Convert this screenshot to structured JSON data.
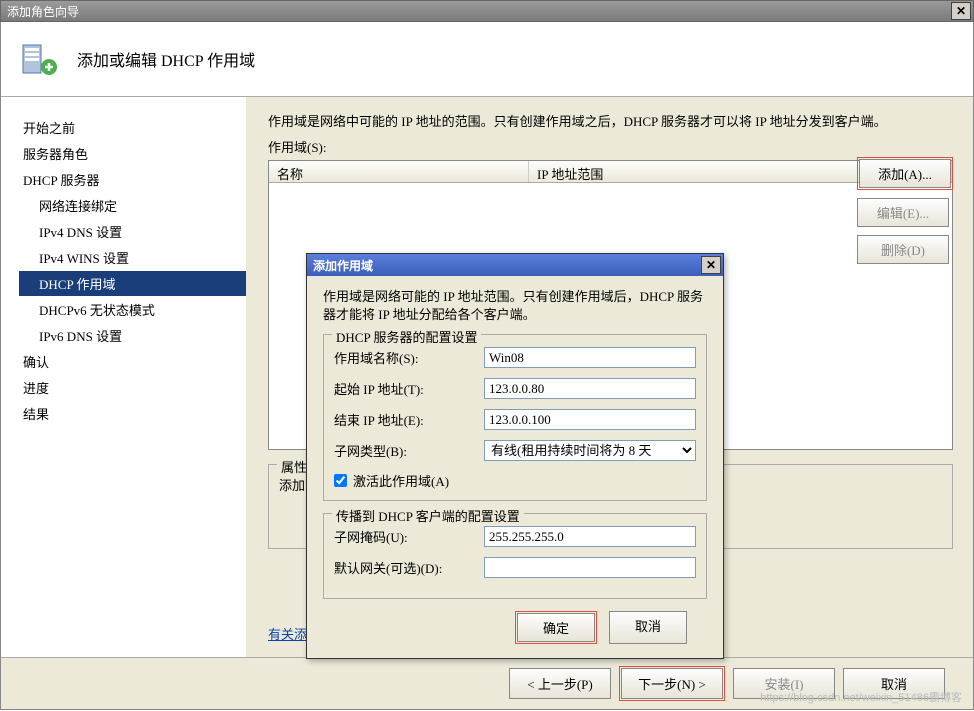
{
  "window": {
    "title": "添加角色向导",
    "header_title": "添加或编辑 DHCP 作用域"
  },
  "sidebar": {
    "items": [
      {
        "label": "开始之前",
        "sub": false
      },
      {
        "label": "服务器角色",
        "sub": false
      },
      {
        "label": "DHCP 服务器",
        "sub": false
      },
      {
        "label": "网络连接绑定",
        "sub": true
      },
      {
        "label": "IPv4 DNS 设置",
        "sub": true
      },
      {
        "label": "IPv4 WINS 设置",
        "sub": true
      },
      {
        "label": "DHCP 作用域",
        "sub": true,
        "selected": true
      },
      {
        "label": "DHCPv6 无状态模式",
        "sub": true
      },
      {
        "label": "IPv6 DNS 设置",
        "sub": true
      },
      {
        "label": "确认",
        "sub": false
      },
      {
        "label": "进度",
        "sub": false
      },
      {
        "label": "结果",
        "sub": false
      }
    ]
  },
  "main": {
    "description": "作用域是网络中可能的 IP 地址的范围。只有创建作用域之后，DHCP 服务器才可以将 IP 地址分发到客户端。",
    "scope_label": "作用域(S):",
    "columns": {
      "name": "名称",
      "range": "IP 地址范围"
    },
    "buttons": {
      "add": "添加(A)...",
      "edit": "编辑(E)...",
      "delete": "删除(D)"
    },
    "props_legend": "属性",
    "props_hint": "添加或",
    "help_link": "有关添"
  },
  "dialog": {
    "title": "添加作用域",
    "description": "作用域是网络可能的 IP 地址范围。只有创建作用域后，DHCP 服务器才能将 IP 地址分配给各个客户端。",
    "group1_legend": "DHCP 服务器的配置设置",
    "group2_legend": "传播到 DHCP 客户端的配置设置",
    "fields": {
      "scope_name_label": "作用域名称(S):",
      "scope_name_value": "Win08",
      "start_ip_label": "起始 IP 地址(T):",
      "start_ip_value": "123.0.0.80",
      "end_ip_label": "结束 IP 地址(E):",
      "end_ip_value": "123.0.0.100",
      "subnet_type_label": "子网类型(B):",
      "subnet_type_value": "有线(租用持续时间将为 8 天",
      "activate_label": "激活此作用域(A)",
      "subnet_mask_label": "子网掩码(U):",
      "subnet_mask_value": "255.255.255.0",
      "gateway_label": "默认网关(可选)(D):",
      "gateway_value": ""
    },
    "buttons": {
      "ok": "确定",
      "cancel": "取消"
    }
  },
  "footer": {
    "prev": "< 上一步(P)",
    "next": "下一步(N) >",
    "install": "安装(I)",
    "cancel": "取消"
  },
  "watermark": "https://blog.csdn.net/weixin_51486霸博客"
}
